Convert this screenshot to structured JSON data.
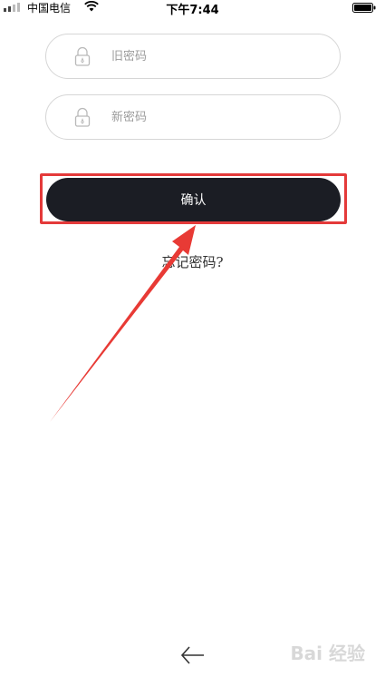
{
  "status_bar": {
    "carrier": "中国电信",
    "time": "下午7:44"
  },
  "form": {
    "old_password_placeholder": "旧密码",
    "new_password_placeholder": "新密码",
    "confirm_label": "确认",
    "forgot_label": "忘记密码?"
  },
  "watermark": {
    "text": "Bai 经验"
  },
  "colors": {
    "button_bg": "#1b1d24",
    "highlight_red": "#e43a3a",
    "field_border": "#d6d6d6"
  }
}
